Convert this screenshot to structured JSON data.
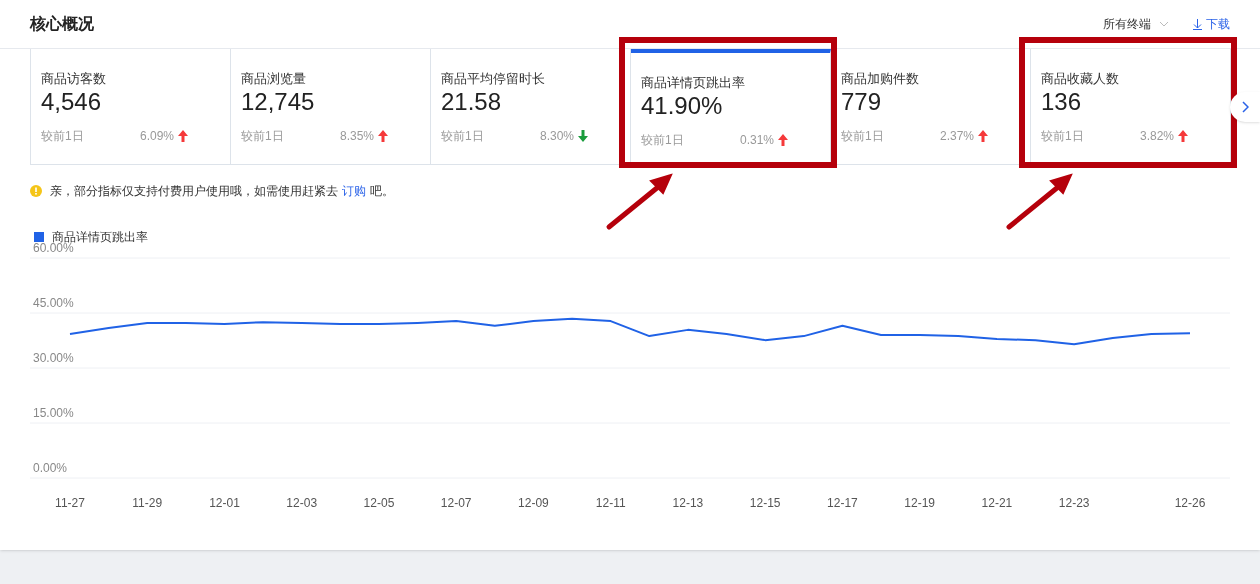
{
  "header": {
    "title": "核心概况",
    "terminal_select": "所有终端",
    "download": "下载"
  },
  "metrics": [
    {
      "label": "商品访客数",
      "value": "4,546",
      "compare": "较前1日",
      "change": "6.09%",
      "rising": true,
      "selected": false,
      "annotated": false
    },
    {
      "label": "商品浏览量",
      "value": "12,745",
      "compare": "较前1日",
      "change": "8.35%",
      "rising": true,
      "selected": false,
      "annotated": false
    },
    {
      "label": "商品平均停留时长",
      "value": "21.58",
      "compare": "较前1日",
      "change": "8.30%",
      "rising": false,
      "selected": false,
      "annotated": false
    },
    {
      "label": "商品详情页跳出率",
      "value": "41.90%",
      "compare": "较前1日",
      "change": "0.31%",
      "rising": true,
      "selected": true,
      "annotated": true
    },
    {
      "label": "商品加购件数",
      "value": "779",
      "compare": "较前1日",
      "change": "2.37%",
      "rising": true,
      "selected": false,
      "annotated": false
    },
    {
      "label": "商品收藏人数",
      "value": "136",
      "compare": "较前1日",
      "change": "3.82%",
      "rising": true,
      "selected": false,
      "annotated": true
    }
  ],
  "notice": {
    "text": "亲，部分指标仅支持付费用户使用哦，如需使用赶紧去",
    "link": "订购",
    "suffix": "吧。"
  },
  "chart_data": {
    "type": "line",
    "categories": [
      "11-27",
      null,
      "11-29",
      null,
      "12-01",
      null,
      "12-03",
      null,
      "12-05",
      null,
      "12-07",
      null,
      "12-09",
      null,
      "12-11",
      null,
      "12-13",
      null,
      "12-15",
      null,
      "12-17",
      null,
      "12-19",
      null,
      "12-21",
      null,
      "12-23",
      null,
      null,
      "12-26"
    ],
    "grid": true,
    "series": [
      {
        "name": "商品详情页跳出率",
        "color": "#2062e6",
        "values": [
          39.3,
          40.9,
          42.3,
          42.3,
          42.0,
          42.5,
          42.3,
          42.0,
          42.0,
          42.3,
          42.8,
          41.5,
          42.8,
          43.4,
          42.8,
          38.7,
          40.4,
          39.3,
          37.6,
          38.7,
          41.5,
          39.0,
          39.0,
          38.7,
          37.9,
          37.6,
          36.5,
          38.2,
          39.3,
          39.5
        ]
      }
    ],
    "ylim": [
      0,
      60
    ],
    "yticks": [
      {
        "value": 0,
        "label": "0.00%"
      },
      {
        "value": 15,
        "label": "15.00%"
      },
      {
        "value": 30,
        "label": "30.00%"
      },
      {
        "value": 45,
        "label": "45.00%"
      },
      {
        "value": 60,
        "label": "60.00%"
      }
    ]
  }
}
